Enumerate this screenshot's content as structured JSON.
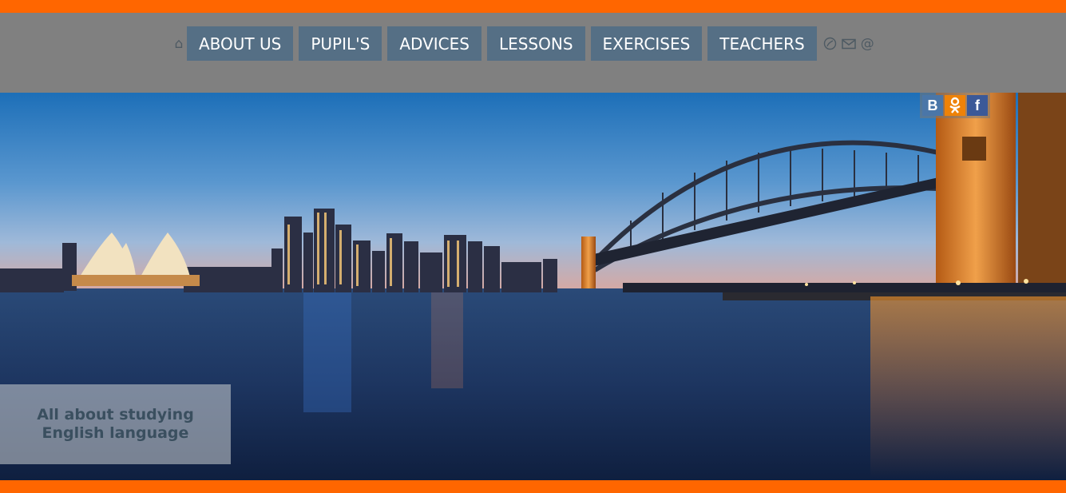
{
  "nav": {
    "items": [
      {
        "label": "ABOUT US"
      },
      {
        "label": "PUPIL'S"
      },
      {
        "label": "ADVICES"
      },
      {
        "label": "LESSONS"
      },
      {
        "label": "EXERCISES"
      },
      {
        "label": "TEACHERS"
      }
    ],
    "icons": [
      "home-icon",
      "phone-icon",
      "mail-icon",
      "at-icon"
    ]
  },
  "social": [
    {
      "name": "vk-icon",
      "glyph": "B",
      "color": "#4a76a8"
    },
    {
      "name": "odnoklassniki-icon",
      "glyph": "OK",
      "color": "#ee8208"
    },
    {
      "name": "facebook-icon",
      "glyph": "f",
      "color": "#3b5998"
    }
  ],
  "hero": {
    "tagline": "All about studying English language"
  },
  "colors": {
    "accent": "#ff6600",
    "header_bg": "#808080",
    "nav_item_bg": "#556f85"
  }
}
